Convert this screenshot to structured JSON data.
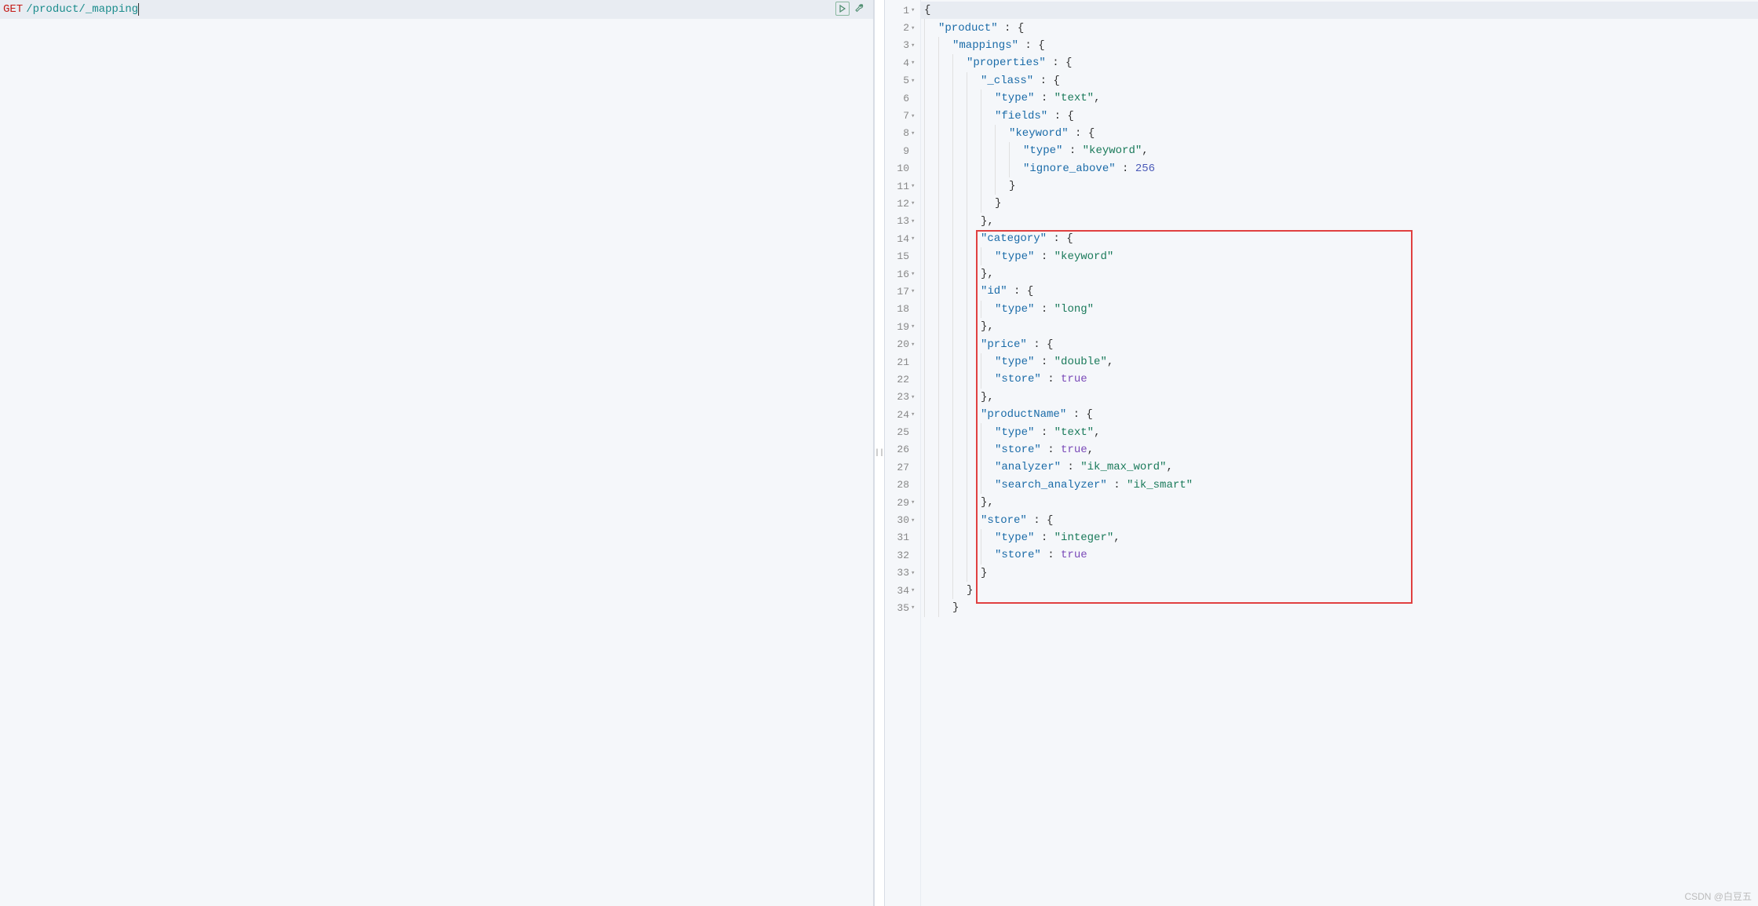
{
  "request": {
    "method": "GET",
    "url": "/product/_mapping"
  },
  "response": {
    "lines": [
      {
        "num": "1",
        "fold": true,
        "highlighted": true,
        "tokens": [
          {
            "t": "punct",
            "v": "{"
          }
        ]
      },
      {
        "num": "2",
        "fold": true,
        "tokens": [
          {
            "t": "indent",
            "n": 1
          },
          {
            "t": "key",
            "v": "\"product\""
          },
          {
            "t": "punct",
            "v": " : {"
          }
        ]
      },
      {
        "num": "3",
        "fold": true,
        "tokens": [
          {
            "t": "indent",
            "n": 2
          },
          {
            "t": "key",
            "v": "\"mappings\""
          },
          {
            "t": "punct",
            "v": " : {"
          }
        ]
      },
      {
        "num": "4",
        "fold": true,
        "tokens": [
          {
            "t": "indent",
            "n": 3
          },
          {
            "t": "key",
            "v": "\"properties\""
          },
          {
            "t": "punct",
            "v": " : {"
          }
        ]
      },
      {
        "num": "5",
        "fold": true,
        "tokens": [
          {
            "t": "indent",
            "n": 4
          },
          {
            "t": "key",
            "v": "\"_class\""
          },
          {
            "t": "punct",
            "v": " : {"
          }
        ]
      },
      {
        "num": "6",
        "tokens": [
          {
            "t": "indent",
            "n": 5
          },
          {
            "t": "key",
            "v": "\"type\""
          },
          {
            "t": "punct",
            "v": " : "
          },
          {
            "t": "string",
            "v": "\"text\""
          },
          {
            "t": "punct",
            "v": ","
          }
        ]
      },
      {
        "num": "7",
        "fold": true,
        "tokens": [
          {
            "t": "indent",
            "n": 5
          },
          {
            "t": "key",
            "v": "\"fields\""
          },
          {
            "t": "punct",
            "v": " : {"
          }
        ]
      },
      {
        "num": "8",
        "fold": true,
        "tokens": [
          {
            "t": "indent",
            "n": 6
          },
          {
            "t": "key",
            "v": "\"keyword\""
          },
          {
            "t": "punct",
            "v": " : {"
          }
        ]
      },
      {
        "num": "9",
        "tokens": [
          {
            "t": "indent",
            "n": 7
          },
          {
            "t": "key",
            "v": "\"type\""
          },
          {
            "t": "punct",
            "v": " : "
          },
          {
            "t": "string",
            "v": "\"keyword\""
          },
          {
            "t": "punct",
            "v": ","
          }
        ]
      },
      {
        "num": "10",
        "tokens": [
          {
            "t": "indent",
            "n": 7
          },
          {
            "t": "key",
            "v": "\"ignore_above\""
          },
          {
            "t": "punct",
            "v": " : "
          },
          {
            "t": "number",
            "v": "256"
          }
        ]
      },
      {
        "num": "11",
        "fold": true,
        "tokens": [
          {
            "t": "indent",
            "n": 6
          },
          {
            "t": "punct",
            "v": "}"
          }
        ]
      },
      {
        "num": "12",
        "fold": true,
        "tokens": [
          {
            "t": "indent",
            "n": 5
          },
          {
            "t": "punct",
            "v": "}"
          }
        ]
      },
      {
        "num": "13",
        "fold": true,
        "tokens": [
          {
            "t": "indent",
            "n": 4
          },
          {
            "t": "punct",
            "v": "},"
          }
        ]
      },
      {
        "num": "14",
        "fold": true,
        "tokens": [
          {
            "t": "indent",
            "n": 4
          },
          {
            "t": "key",
            "v": "\"category\""
          },
          {
            "t": "punct",
            "v": " : {"
          }
        ]
      },
      {
        "num": "15",
        "tokens": [
          {
            "t": "indent",
            "n": 5
          },
          {
            "t": "key",
            "v": "\"type\""
          },
          {
            "t": "punct",
            "v": " : "
          },
          {
            "t": "string",
            "v": "\"keyword\""
          }
        ]
      },
      {
        "num": "16",
        "fold": true,
        "tokens": [
          {
            "t": "indent",
            "n": 4
          },
          {
            "t": "punct",
            "v": "},"
          }
        ]
      },
      {
        "num": "17",
        "fold": true,
        "tokens": [
          {
            "t": "indent",
            "n": 4
          },
          {
            "t": "key",
            "v": "\"id\""
          },
          {
            "t": "punct",
            "v": " : {"
          }
        ]
      },
      {
        "num": "18",
        "tokens": [
          {
            "t": "indent",
            "n": 5
          },
          {
            "t": "key",
            "v": "\"type\""
          },
          {
            "t": "punct",
            "v": " : "
          },
          {
            "t": "string",
            "v": "\"long\""
          }
        ]
      },
      {
        "num": "19",
        "fold": true,
        "tokens": [
          {
            "t": "indent",
            "n": 4
          },
          {
            "t": "punct",
            "v": "},"
          }
        ]
      },
      {
        "num": "20",
        "fold": true,
        "tokens": [
          {
            "t": "indent",
            "n": 4
          },
          {
            "t": "key",
            "v": "\"price\""
          },
          {
            "t": "punct",
            "v": " : {"
          }
        ]
      },
      {
        "num": "21",
        "tokens": [
          {
            "t": "indent",
            "n": 5
          },
          {
            "t": "key",
            "v": "\"type\""
          },
          {
            "t": "punct",
            "v": " : "
          },
          {
            "t": "string",
            "v": "\"double\""
          },
          {
            "t": "punct",
            "v": ","
          }
        ]
      },
      {
        "num": "22",
        "tokens": [
          {
            "t": "indent",
            "n": 5
          },
          {
            "t": "key",
            "v": "\"store\""
          },
          {
            "t": "punct",
            "v": " : "
          },
          {
            "t": "boolean",
            "v": "true"
          }
        ]
      },
      {
        "num": "23",
        "fold": true,
        "tokens": [
          {
            "t": "indent",
            "n": 4
          },
          {
            "t": "punct",
            "v": "},"
          }
        ]
      },
      {
        "num": "24",
        "fold": true,
        "tokens": [
          {
            "t": "indent",
            "n": 4
          },
          {
            "t": "key",
            "v": "\"productName\""
          },
          {
            "t": "punct",
            "v": " : {"
          }
        ]
      },
      {
        "num": "25",
        "tokens": [
          {
            "t": "indent",
            "n": 5
          },
          {
            "t": "key",
            "v": "\"type\""
          },
          {
            "t": "punct",
            "v": " : "
          },
          {
            "t": "string",
            "v": "\"text\""
          },
          {
            "t": "punct",
            "v": ","
          }
        ]
      },
      {
        "num": "26",
        "tokens": [
          {
            "t": "indent",
            "n": 5
          },
          {
            "t": "key",
            "v": "\"store\""
          },
          {
            "t": "punct",
            "v": " : "
          },
          {
            "t": "boolean",
            "v": "true"
          },
          {
            "t": "punct",
            "v": ","
          }
        ]
      },
      {
        "num": "27",
        "tokens": [
          {
            "t": "indent",
            "n": 5
          },
          {
            "t": "key",
            "v": "\"analyzer\""
          },
          {
            "t": "punct",
            "v": " : "
          },
          {
            "t": "string",
            "v": "\"ik_max_word\""
          },
          {
            "t": "punct",
            "v": ","
          }
        ]
      },
      {
        "num": "28",
        "tokens": [
          {
            "t": "indent",
            "n": 5
          },
          {
            "t": "key",
            "v": "\"search_analyzer\""
          },
          {
            "t": "punct",
            "v": " : "
          },
          {
            "t": "string",
            "v": "\"ik_smart\""
          }
        ]
      },
      {
        "num": "29",
        "fold": true,
        "tokens": [
          {
            "t": "indent",
            "n": 4
          },
          {
            "t": "punct",
            "v": "},"
          }
        ]
      },
      {
        "num": "30",
        "fold": true,
        "tokens": [
          {
            "t": "indent",
            "n": 4
          },
          {
            "t": "key",
            "v": "\"store\""
          },
          {
            "t": "punct",
            "v": " : {"
          }
        ]
      },
      {
        "num": "31",
        "tokens": [
          {
            "t": "indent",
            "n": 5
          },
          {
            "t": "key",
            "v": "\"type\""
          },
          {
            "t": "punct",
            "v": " : "
          },
          {
            "t": "string",
            "v": "\"integer\""
          },
          {
            "t": "punct",
            "v": ","
          }
        ]
      },
      {
        "num": "32",
        "tokens": [
          {
            "t": "indent",
            "n": 5
          },
          {
            "t": "key",
            "v": "\"store\""
          },
          {
            "t": "punct",
            "v": " : "
          },
          {
            "t": "boolean",
            "v": "true"
          }
        ]
      },
      {
        "num": "33",
        "fold": true,
        "tokens": [
          {
            "t": "indent",
            "n": 4
          },
          {
            "t": "punct",
            "v": "}"
          }
        ]
      },
      {
        "num": "34",
        "fold": true,
        "tokens": [
          {
            "t": "indent",
            "n": 3
          },
          {
            "t": "punct",
            "v": "}"
          }
        ]
      },
      {
        "num": "35",
        "fold": true,
        "tokens": [
          {
            "t": "indent",
            "n": 2
          },
          {
            "t": "punct",
            "v": "}"
          }
        ]
      }
    ]
  },
  "watermark": "CSDN @白豆五"
}
